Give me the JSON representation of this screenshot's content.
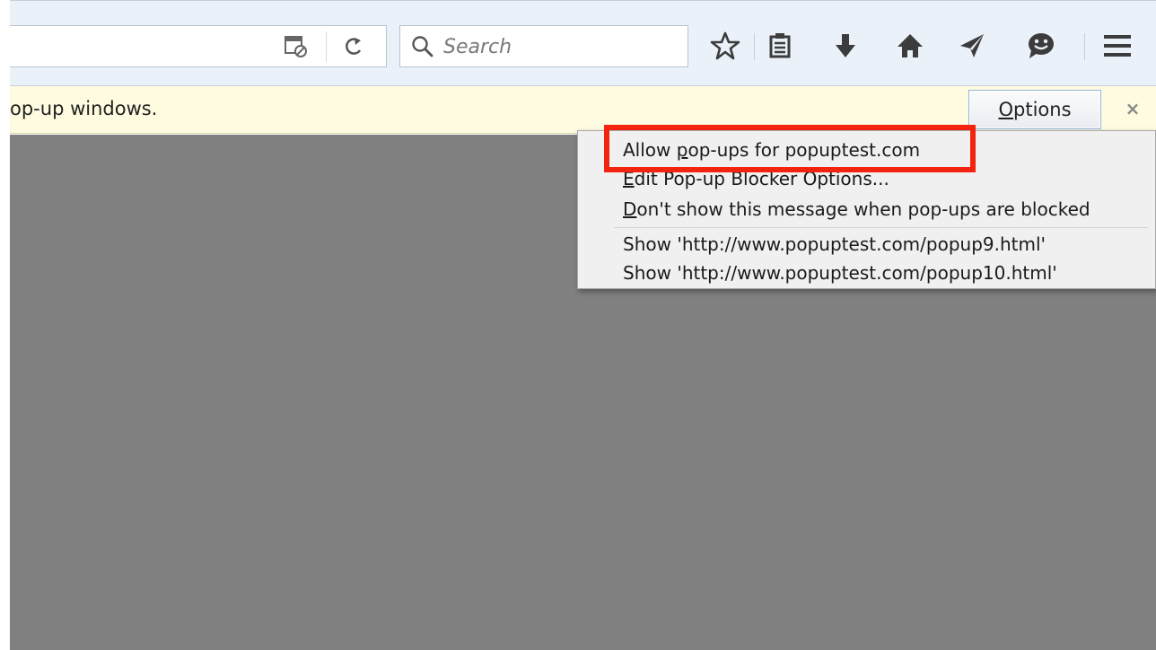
{
  "toolbar": {
    "search_placeholder": "Search",
    "icons": {
      "identity": "page-identity-icon",
      "reload": "reload-icon",
      "search": "search-icon",
      "bookmark": "star-icon",
      "reading_list": "reading-list-icon",
      "downloads": "download-arrow-icon",
      "home": "home-icon",
      "pocket": "send-icon",
      "hello": "chat-smile-icon",
      "menu": "hamburger-menu-icon"
    }
  },
  "notification": {
    "message": "op-up windows.",
    "options_label": "Options",
    "options_accesskey": "O",
    "options_rest": "ptions",
    "close_glyph": "×"
  },
  "popup_menu": {
    "items": [
      {
        "pre": "Allow ",
        "key": "p",
        "post": "op-ups for popuptest.com"
      },
      {
        "pre": "",
        "key": "E",
        "post": "dit Pop-up Blocker Options..."
      },
      {
        "pre": "",
        "key": "D",
        "post": "on't show this message when pop-ups are blocked"
      },
      {
        "pre": "",
        "key": "",
        "post": "Show 'http://www.popuptest.com/popup9.html'"
      },
      {
        "pre": "",
        "key": "",
        "post": "Show 'http://www.popuptest.com/popup10.html'"
      }
    ]
  },
  "colors": {
    "highlight": "#f2230f",
    "content_bg": "#808080",
    "notification_bg": "#fffbe0",
    "toolbar_bg": "#eaf1f9"
  }
}
